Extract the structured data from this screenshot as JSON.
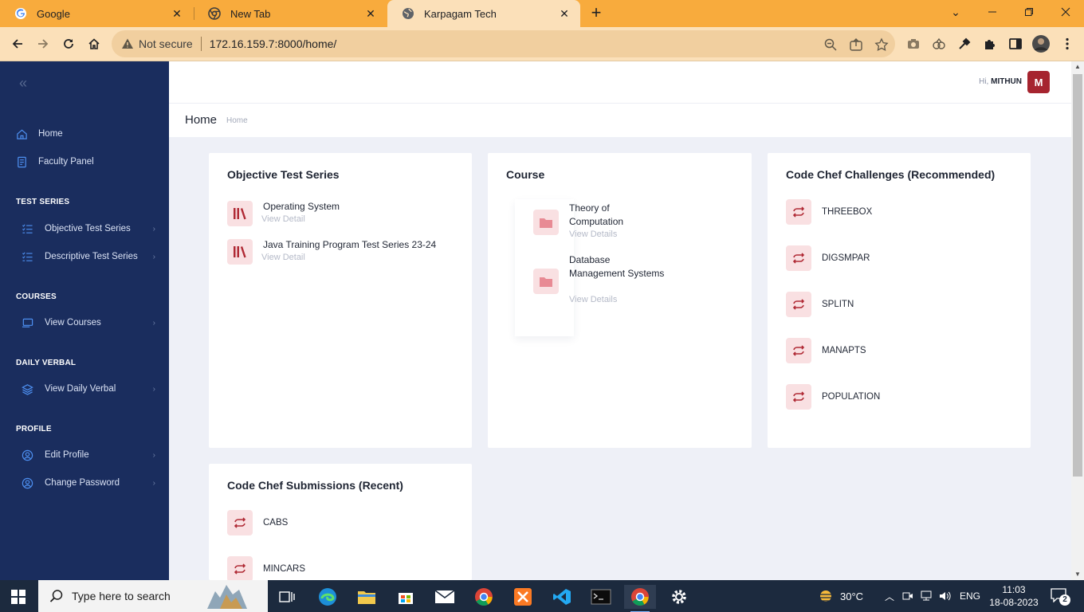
{
  "browser": {
    "tabs": [
      {
        "label": "Google",
        "icon": "google-icon"
      },
      {
        "label": "New Tab",
        "icon": "chrome-icon"
      },
      {
        "label": "Karpagam Tech",
        "icon": "globe-icon"
      }
    ],
    "security_label": "Not secure",
    "url": "172.16.159.7:8000/home/"
  },
  "sidebar": {
    "items": [
      {
        "label": "Home",
        "icon": "home-icon"
      },
      {
        "label": "Faculty Panel",
        "icon": "document-icon"
      }
    ],
    "sections": [
      {
        "heading": "TEST SERIES",
        "items": [
          {
            "label": "Objective Test Series",
            "icon": "list-icon"
          },
          {
            "label": "Descriptive Test Series",
            "icon": "list-icon"
          }
        ]
      },
      {
        "heading": "COURSES",
        "items": [
          {
            "label": "View Courses",
            "icon": "monitor-icon"
          }
        ]
      },
      {
        "heading": "DAILY VERBAL",
        "items": [
          {
            "label": "View Daily Verbal",
            "icon": "layers-icon"
          }
        ]
      },
      {
        "heading": "PROFILE",
        "items": [
          {
            "label": "Edit Profile",
            "icon": "user-circle-icon"
          },
          {
            "label": "Change Password",
            "icon": "user-circle-icon"
          }
        ]
      }
    ]
  },
  "header": {
    "greeting": "Hi,",
    "user_name": "MITHUN",
    "avatar_letter": "M"
  },
  "breadcrumb": {
    "title": "Home",
    "crumb": "Home"
  },
  "objective_card": {
    "title": "Objective Test Series",
    "items": [
      {
        "title": "Operating System",
        "sub": "View Detail"
      },
      {
        "title": "Java Training Program Test Series 23-24",
        "sub": "View Detail"
      }
    ]
  },
  "course_card": {
    "title": "Course",
    "items": [
      {
        "name": "Theory of Computation",
        "sub": "View Details"
      },
      {
        "name": "Database Management Systems",
        "sub": "View Details"
      }
    ]
  },
  "challenges_card": {
    "title": "Code Chef Challenges (Recommended)",
    "items": [
      "THREEBOX",
      "DIGSMPAR",
      "SPLITN",
      "MANAPTS",
      "POPULATION"
    ]
  },
  "submissions_card": {
    "title": "Code Chef Submissions (Recent)",
    "items": [
      "CABS",
      "MINCARS"
    ]
  },
  "taskbar": {
    "search_placeholder": "Type here to search",
    "weather": "30°C",
    "language": "ENG",
    "time": "11:03",
    "date": "18-08-2023",
    "notification_count": "2"
  },
  "colors": {
    "tabbar": "#f8ab3d",
    "toolbar": "#fbe0b9",
    "sidebar": "#1a2d5e",
    "accent_red": "#a6242f",
    "icon_bg": "#f9e0e2"
  }
}
